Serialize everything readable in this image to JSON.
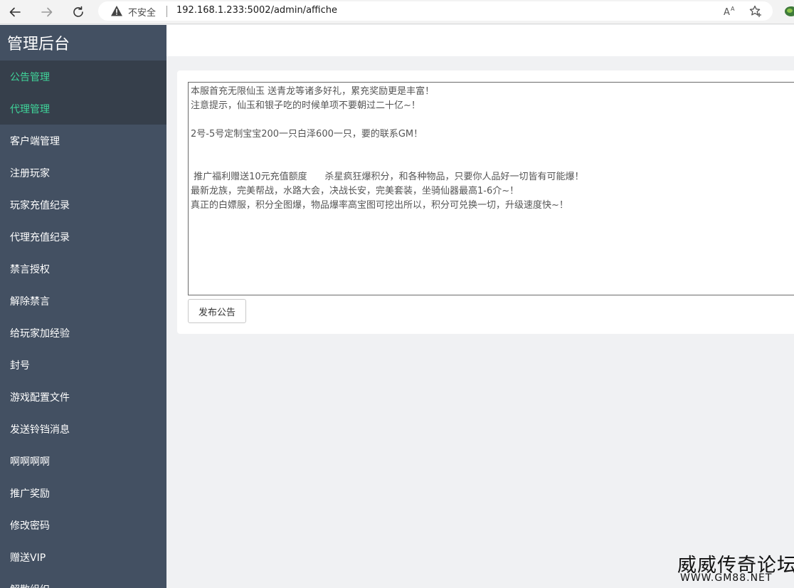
{
  "browser": {
    "insecure_label": "不安全",
    "url": "192.168.1.233:5002/admin/affiche",
    "icons": [
      "back-icon",
      "forward-icon",
      "reload-icon",
      "warning-icon",
      "read-aloud-icon",
      "favorite-icon",
      "extension-icon"
    ]
  },
  "sidebar": {
    "title": "管理后台",
    "items": [
      {
        "label": "公告管理"
      },
      {
        "label": "代理管理"
      },
      {
        "label": "客户端管理"
      },
      {
        "label": "注册玩家"
      },
      {
        "label": "玩家充值纪录"
      },
      {
        "label": "代理充值纪录"
      },
      {
        "label": "禁言授权"
      },
      {
        "label": "解除禁言"
      },
      {
        "label": "给玩家加经验"
      },
      {
        "label": "封号"
      },
      {
        "label": "游戏配置文件"
      },
      {
        "label": "发送铃铛消息"
      },
      {
        "label": "啊啊啊啊"
      },
      {
        "label": "推广奖励"
      },
      {
        "label": "修改密码"
      },
      {
        "label": "赠送VIP"
      },
      {
        "label": "解散组织"
      }
    ],
    "accent_color": "#3fd49a",
    "background_color": "#435062"
  },
  "main": {
    "notice_text": "本服首充无限仙玉 送青龙等诸多好礼，累充奖励更是丰富！\n注意提示，仙玉和银子吃的时候单项不要朝过二十亿~！\n\n2号-5号定制宝宝200一只白泽600一只，要的联系GM！\n\n\n 推广福利赠送10元充值额度      杀星疯狂爆积分，和各种物品，只要你人品好一切皆有可能爆！\n最新龙族，完美帮战，水路大会，决战长安，完美套装，坐骑仙器最高1-6介~！\n真正的白嫖服，积分全图爆，物品爆率高宝图可挖出所以，积分可兑换一切，升级速度快~！",
    "publish_label": "发布公告"
  },
  "watermark": {
    "title": "威威传奇论坛",
    "url": "WWW.GM88.NET"
  }
}
